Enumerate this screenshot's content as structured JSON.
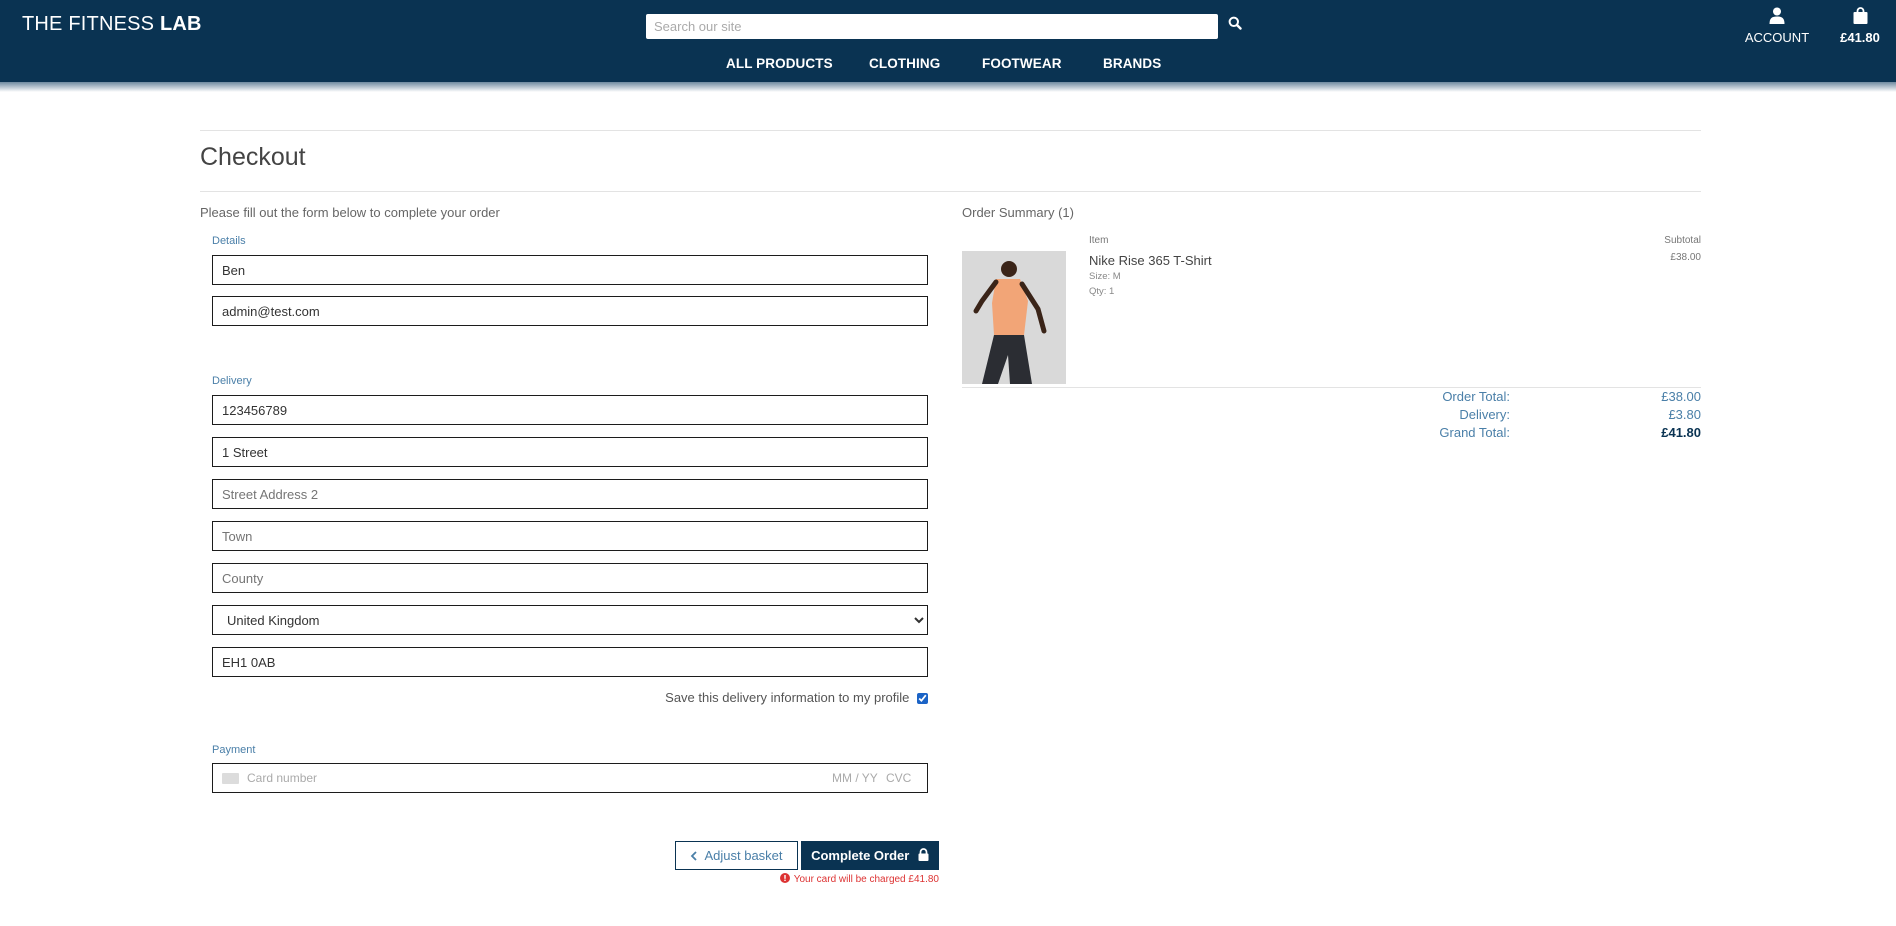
{
  "header": {
    "logo_prefix": "THE FITNESS ",
    "logo_bold": "LAB",
    "search_placeholder": "Search our site",
    "account_label": "ACCOUNT",
    "bag_total": "£41.80",
    "nav": [
      "ALL PRODUCTS",
      "CLOTHING",
      "FOOTWEAR",
      "BRANDS"
    ]
  },
  "page": {
    "title": "Checkout",
    "intro": "Please fill out the form below to complete your order"
  },
  "form": {
    "details_label": "Details",
    "full_name": "Ben",
    "email": "admin@test.com",
    "delivery_label": "Delivery",
    "phone": "123456789",
    "street1": "1 Street",
    "street2_placeholder": "Street Address 2",
    "town_placeholder": "Town",
    "county_placeholder": "County",
    "country": "United Kingdom",
    "postcode": "EH1 0AB",
    "save_info_label": "Save this delivery information to my profile",
    "save_info_checked": true,
    "payment_label": "Payment",
    "card_number_placeholder": "Card number",
    "card_expiry_placeholder": "MM / YY",
    "card_cvc_placeholder": "CVC"
  },
  "actions": {
    "adjust_label": "Adjust basket",
    "complete_label": "Complete Order",
    "charge_note": "Your card will be charged",
    "charge_amount": "£41.80"
  },
  "summary": {
    "title": "Order Summary (1)",
    "item_header": "Item",
    "subtotal_header": "Subtotal",
    "item": {
      "name": "Nike Rise 365 T-Shirt",
      "size": "Size: M",
      "qty": "Qty: 1",
      "price": "£38.00"
    },
    "order_total_label": "Order Total:",
    "order_total": "£38.00",
    "delivery_label": "Delivery:",
    "delivery": "£3.80",
    "grand_total_label": "Grand Total:",
    "grand_total": "£41.80"
  },
  "colors": {
    "brand_navy": "#0a3352",
    "accent_blue": "#4a7fa8",
    "error_red": "#dd3333"
  }
}
